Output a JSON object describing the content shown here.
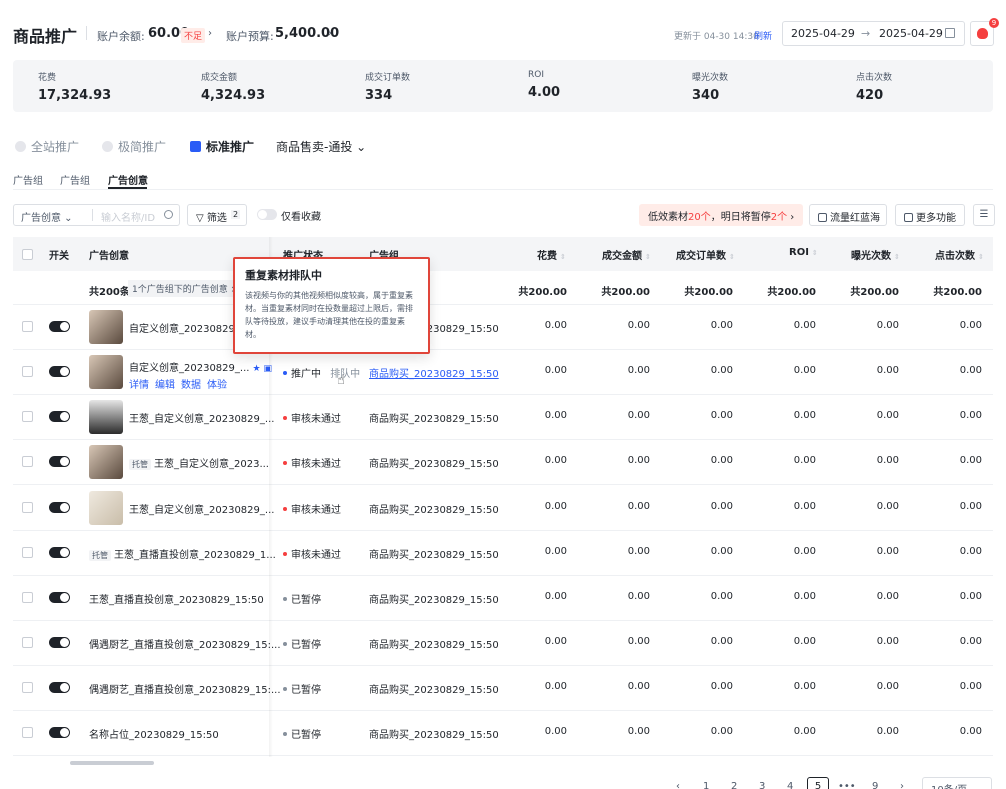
{
  "header": {
    "title": "商品推广",
    "balance_label": "账户余额:",
    "balance_value": "60.00",
    "balance_tag": "不足",
    "budget_label": "账户预算:",
    "budget_value": "5,400.00",
    "chevron": "›",
    "updated": "更新于 04-30 14:30",
    "refresh": "刷新",
    "date_start": "2025-04-29",
    "date_arrow": "→",
    "date_end": "2025-04-29",
    "notif_count": "9"
  },
  "stats": [
    {
      "label": "花费",
      "value": "17,324.93"
    },
    {
      "label": "成交金额",
      "value": "4,324.93"
    },
    {
      "label": "成交订单数",
      "value": "334"
    },
    {
      "label": "ROI",
      "value": "4.00"
    },
    {
      "label": "曝光次数",
      "value": "340"
    },
    {
      "label": "点击次数",
      "value": "420"
    }
  ],
  "modes": [
    "全站推广",
    "极简推广",
    "标准推广",
    "商品售卖-通投"
  ],
  "mode_chevron": "⌄",
  "tabs": [
    "广告组",
    "广告组",
    "广告创意"
  ],
  "toolbar": {
    "select_label": "广告创意 ⌄",
    "search_placeholder": "输入名称/ID",
    "filter_label": "筛选",
    "filter_count": "2",
    "fav_label": "仅看收藏",
    "warn_pre": "低效素材",
    "warn_num1": "20个",
    "warn_mid": "，明日将暂停",
    "warn_num2": "2个",
    "warn_post": " ›",
    "btn_bluesea": "流量红蓝海",
    "btn_more": "更多功能",
    "btn_settings": "☰"
  },
  "table": {
    "headers": {
      "switch": "开关",
      "creative": "广告创意",
      "status": "推广状态",
      "group": "广告组",
      "cost": "花费",
      "gmv": "成交金额",
      "orders": "成交订单数",
      "roi": "ROI",
      "impr": "曝光次数",
      "clicks": "点击次数"
    },
    "sort_icon": "⇕",
    "summary": {
      "label": "共200条",
      "chip": "1个广告组下的广告创意 ×",
      "values": [
        "共200.00",
        "共200.00",
        "共200.00",
        "共200.00",
        "共200.00",
        "共200.00"
      ]
    },
    "row_links": [
      "详情",
      "编辑",
      "数据",
      "体验"
    ],
    "rows": [
      {
        "name": "自定义创意_20230829_1",
        "tag": "",
        "status": "",
        "status_color": "",
        "group": "商品购买_20230829_15:50",
        "link": false
      },
      {
        "name": "自定义创意_20230829_...",
        "tag": "",
        "status": "推广中",
        "extra": "排队中",
        "status_color": "#2a5cf6",
        "group": "商品购买_20230829_15:50",
        "link": true
      },
      {
        "name": "王葱_自定义创意_20230829_...",
        "tag": "",
        "status": "审核未通过",
        "status_color": "#f53f3f",
        "group": "商品购买_20230829_15:50",
        "link": false
      },
      {
        "name": "王葱_自定义创意_2023...",
        "tag": "托管",
        "status": "审核未通过",
        "status_color": "#f53f3f",
        "group": "商品购买_20230829_15:50",
        "link": false
      },
      {
        "name": "王葱_自定义创意_20230829_...",
        "tag": "",
        "status": "审核未通过",
        "status_color": "#f53f3f",
        "group": "商品购买_20230829_15:50",
        "link": false
      },
      {
        "name": "王葱_直播直投创意_20230829_1...",
        "tag": "托管",
        "status": "审核未通过",
        "status_color": "#f53f3f",
        "group": "商品购买_20230829_15:50",
        "link": false
      },
      {
        "name": "王葱_直播直投创意_20230829_15:50",
        "tag": "",
        "status": "已暂停",
        "status_color": "#86909c",
        "group": "商品购买_20230829_15:50",
        "link": false
      },
      {
        "name": "偶遇厨艺_直播直投创意_20230829_15:...",
        "tag": "",
        "status": "已暂停",
        "status_color": "#86909c",
        "group": "商品购买_20230829_15:50",
        "link": false
      },
      {
        "name": "偶遇厨艺_直播直投创意_20230829_15:...",
        "tag": "",
        "status": "已暂停",
        "status_color": "#86909c",
        "group": "商品购买_20230829_15:50",
        "link": false
      },
      {
        "name": "名称占位_20230829_15:50",
        "tag": "",
        "status": "已暂停",
        "status_color": "#86909c",
        "group": "商品购买_20230829_15:50",
        "link": false
      }
    ],
    "cell_value": "0.00"
  },
  "tooltip": {
    "title": "重复素材排队中",
    "body": "该视频与你的其他视频相似度较高，属于重复素材。当重复素材同时在投数量超过上限后，需排队等待投放，建议手动清理其他在投的重复素材。"
  },
  "pager": {
    "prev": "‹",
    "pages": [
      "1",
      "2",
      "3",
      "4"
    ],
    "current": "5",
    "ellipsis": "•••",
    "last": "9",
    "next": "›",
    "size": "10条/页"
  },
  "colors": {
    "accent": "#2a5cf6",
    "danger": "#f53f3f",
    "highlight_border": "#e0453a"
  }
}
